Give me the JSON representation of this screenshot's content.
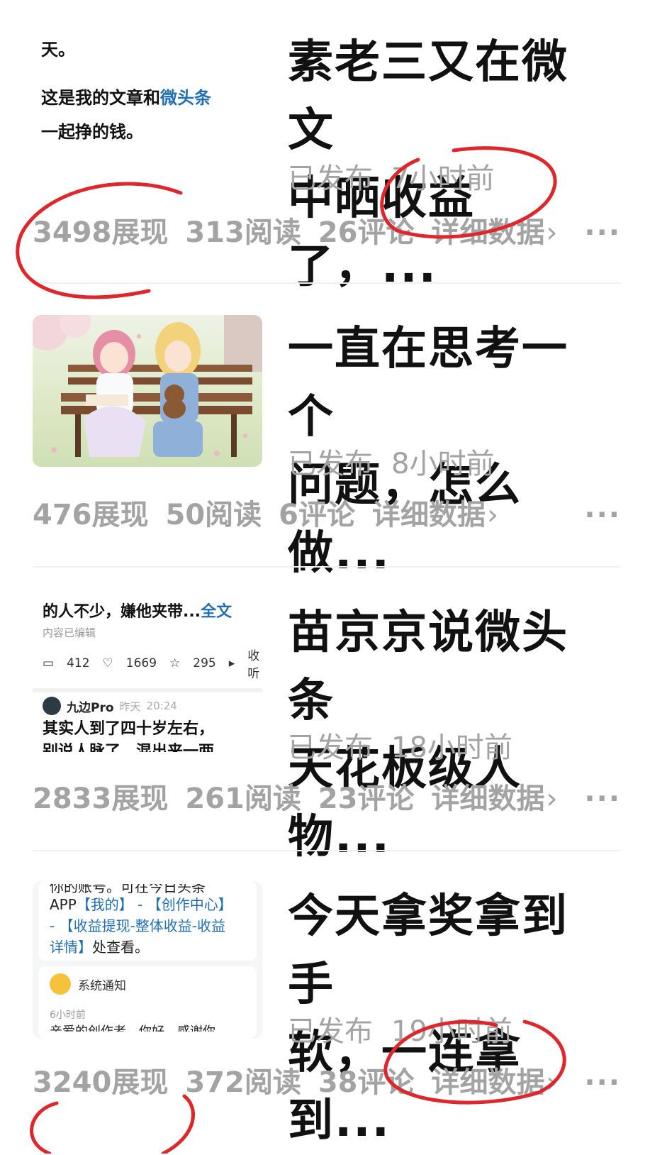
{
  "articles": [
    {
      "thumbnail": {
        "line1": "天。",
        "line2_prefix": "这是我的文章和",
        "line2_link": "微头条",
        "line3": "一起挣的钱。"
      },
      "title": "素老三又在微文\n中晒收益了，...",
      "status": "已发布",
      "time": "7小时前",
      "impressions": "3498展现",
      "reads": "313阅读",
      "comments": "26评论",
      "detail": "详细数据",
      "more": "···"
    },
    {
      "thumbnail": {
        "image_desc": "illustration-two-girls-on-bench"
      },
      "title": "一直在思考一个\n问题，怎么做...",
      "status": "已发布",
      "time": "8小时前",
      "impressions": "476展现",
      "reads": "50阅读",
      "comments": "6评论",
      "detail": "详细数据",
      "more": "···"
    },
    {
      "thumbnail": {
        "snippet": "的人不少，嫌他夹带...",
        "full_text": "全文",
        "edited": "内容已编辑",
        "comment_count": "412",
        "like_count": "1669",
        "fav_count": "295",
        "listen": "收听",
        "author": "九边Pro",
        "day": "昨天",
        "clock": "20:24",
        "body1": "其实人到了四十岁左右，",
        "body2": "别说人脉了，混出来一两"
      },
      "title": "苗京京说微头条\n天花板级人物...",
      "status": "已发布",
      "time": "18小时前",
      "impressions": "2833展现",
      "reads": "261阅读",
      "comments": "23评论",
      "detail": "详细数据",
      "more": "···"
    },
    {
      "thumbnail": {
        "top_cut": "你的账号。可在今日头条",
        "line1_prefix": "APP",
        "line1_a": "【我的】",
        "line1_b": " - ",
        "line1_c": "【创作中心】",
        "line2": "- 【收益提现-整体收益-收益",
        "line3_link": "详情】",
        "line3_rest": "处查看。",
        "notice": "系统通知",
        "ago": "6小时前",
        "bottom_cut": "亲爱的创作者，你好，感谢你"
      },
      "title": "今天拿奖拿到手\n软，一连拿到...",
      "status": "已发布",
      "time": "19小时前",
      "impressions": "3240展现",
      "reads": "372阅读",
      "comments": "38评论",
      "detail": "详细数据",
      "more": "···"
    }
  ],
  "colors": {
    "title": "#111111",
    "meta": "#a3a3a3",
    "link": "#1f6fb7",
    "annotation": "#e0262a"
  }
}
